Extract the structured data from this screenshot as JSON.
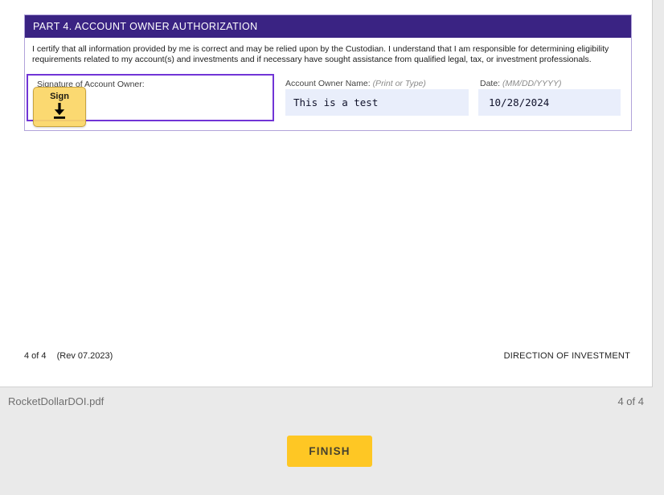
{
  "document": {
    "section_header": "PART 4. ACCOUNT OWNER AUTHORIZATION",
    "certification_text": "I certify that all information provided by me is correct and may be relied upon by the Custodian. I understand that I am responsible for determining eligibility requirements related to my account(s) and investments and if necessary have sought assistance from qualified legal, tax, or investment professionals.",
    "signature": {
      "label": "Signature of Account Owner:",
      "sign_tab_label": "Sign"
    },
    "owner_name": {
      "label": "Account Owner Name:",
      "hint": "(Print or Type)",
      "value": "This is a test"
    },
    "date": {
      "label": "Date:",
      "hint": "(MM/DD/YYYY)",
      "value": "10/28/2024"
    },
    "page_footer": {
      "page_info": "4 of 4",
      "revision": "(Rev 07.2023)",
      "doc_title": "DIRECTION OF INVESTMENT"
    }
  },
  "viewer": {
    "file_name": "RocketDollarDOI.pdf",
    "page_indicator": "4 of 4",
    "finish_button_label": "FINISH"
  },
  "colors": {
    "section_header_bg": "#3a2383",
    "signature_field_border": "#7135d6",
    "section_border": "#b1a3da",
    "input_field_bg": "#e9eefb",
    "sign_tab_bg": "#fbd666",
    "sign_tab_border": "#c8a33e",
    "finish_button_bg": "#fec724",
    "viewer_bg": "#eaeaea"
  }
}
